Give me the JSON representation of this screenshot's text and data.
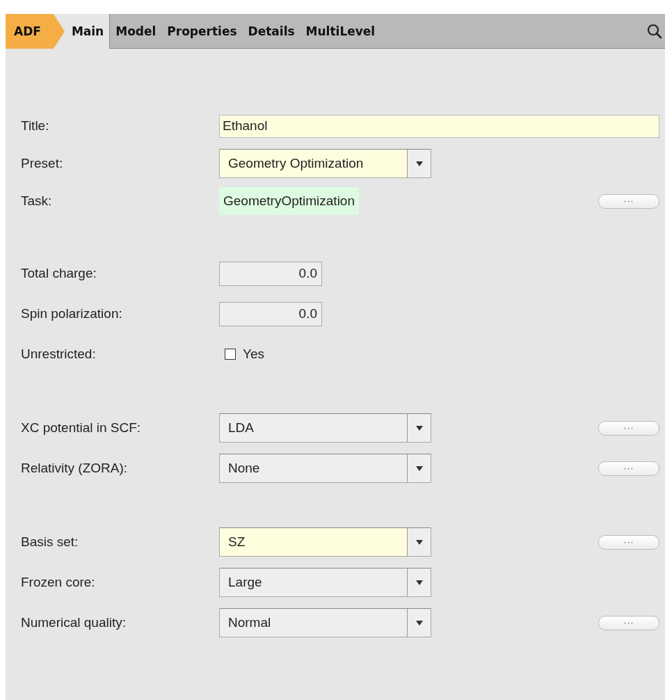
{
  "brand": "ADF",
  "tabs": [
    {
      "label": "Main",
      "selected": true
    },
    {
      "label": "Model",
      "selected": false
    },
    {
      "label": "Properties",
      "selected": false
    },
    {
      "label": "Details",
      "selected": false
    },
    {
      "label": "MultiLevel",
      "selected": false
    }
  ],
  "groups": [
    {
      "rows": [
        {
          "kind": "text",
          "label": "Title:",
          "value": "Ethanol",
          "modified": true
        },
        {
          "kind": "combo",
          "label": "Preset:",
          "value": "Geometry Optimization",
          "modified": true
        },
        {
          "kind": "readonly",
          "label": "Task:",
          "value": "GeometryOptimization",
          "more": "···"
        }
      ]
    },
    {
      "rows": [
        {
          "kind": "number",
          "label": "Total charge:",
          "value": "0.0"
        },
        {
          "kind": "number",
          "label": "Spin polarization:",
          "value": "0.0"
        },
        {
          "kind": "checkbox",
          "label": "Unrestricted:",
          "value": "Yes",
          "checked": false
        }
      ]
    },
    {
      "rows": [
        {
          "kind": "combo",
          "label": "XC potential in SCF:",
          "value": "LDA",
          "modified": false,
          "more": "···"
        },
        {
          "kind": "combo",
          "label": "Relativity (ZORA):",
          "value": "None",
          "modified": false,
          "more": "···"
        }
      ]
    },
    {
      "rows": [
        {
          "kind": "combo",
          "label": "Basis set:",
          "value": "SZ",
          "modified": true,
          "more": "···"
        },
        {
          "kind": "combo",
          "label": "Frozen core:",
          "value": "Large",
          "modified": false
        },
        {
          "kind": "combo",
          "label": "Numerical quality:",
          "value": "Normal",
          "modified": false,
          "more": "···"
        }
      ]
    }
  ]
}
